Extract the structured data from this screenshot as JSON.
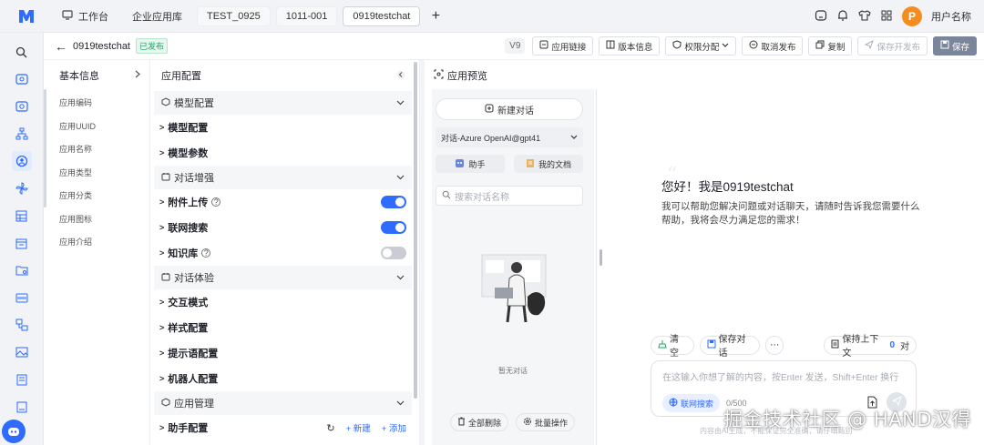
{
  "topbar": {
    "tabs": [
      {
        "label": "工作台",
        "icon": "monitor-icon"
      },
      {
        "label": "企业应用库"
      },
      {
        "label": "TEST_0925"
      },
      {
        "label": "1011-001"
      },
      {
        "label": "0919testchat",
        "active": true
      }
    ],
    "username": "用户名称",
    "avatar_letter": "P"
  },
  "subheader": {
    "title": "0919testchat",
    "status": "已发布",
    "version": "V9",
    "buttons": {
      "app_link": "应用链接",
      "version_info": "版本信息",
      "permission": "权限分配",
      "unpublish": "取消发布",
      "copy": "复制",
      "save_dev": "保存开发布",
      "save": "保存"
    }
  },
  "basic_info": {
    "title": "基本信息",
    "items": [
      "应用编码",
      "应用UUID",
      "应用名称",
      "应用类型",
      "应用分类",
      "应用图标",
      "应用介绍"
    ]
  },
  "app_config": {
    "title": "应用配置",
    "sections": {
      "model": "模型配置",
      "enhance": "对话增强",
      "experience": "对话体验",
      "manage": "应用管理"
    },
    "rows": {
      "model_config": "模型配置",
      "model_params": "模型参数",
      "attach_upload": "附件上传",
      "web_search": "联网搜索",
      "knowledge": "知识库",
      "interaction": "交互模式",
      "style": "样式配置",
      "prompt": "提示语配置",
      "robot": "机器人配置",
      "assistant": "助手配置"
    },
    "toggles": {
      "attach_upload": true,
      "web_search": true,
      "knowledge": false
    },
    "assistant_tools": {
      "new": "新建",
      "add": "添加"
    }
  },
  "preview": {
    "title": "应用预览",
    "new_chat": "新建对话",
    "model_select": "对话-Azure OpenAI@gpt41",
    "assistant_btn": "助手",
    "docs_btn": "我的文档",
    "search_placeholder": "搜索对话名称",
    "empty_text": "暂无对话",
    "delete_all": "全部删除",
    "batch": "批量操作",
    "greeting": "您好！我是0919testchat",
    "intro": "我可以帮助您解决问题或对话聊天，请随时告诉我您需要什么帮助，我将会尽力满足您的需求！",
    "clear": "清空",
    "save_chat": "保存对话",
    "keep_context_label": "保持上下文",
    "keep_context_count": "0",
    "keep_context_unit": "对",
    "input_placeholder": "在这输入你想了解的内容，按Enter 发送，Shift+Enter 换行",
    "web_search_btn": "联网搜索",
    "char_count": "0/500",
    "disclaimer": "内容由AI生成，不能保证完全准确，请仔细甄别"
  },
  "watermark": "掘金技术社区 @ HAND汉得",
  "colors": {
    "accent": "#2f6bff",
    "avatar": "#f58c1f",
    "published": "#26a269"
  }
}
